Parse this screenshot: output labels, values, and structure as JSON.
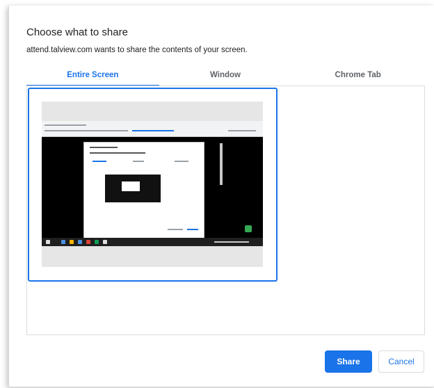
{
  "dialog": {
    "title": "Choose what to share",
    "subtitle": "attend.talview.com wants to share the contents of your screen."
  },
  "tabs": [
    {
      "label": "Entire Screen",
      "active": true
    },
    {
      "label": "Window",
      "active": false
    },
    {
      "label": "Chrome Tab",
      "active": false
    }
  ],
  "buttons": {
    "share_label": "Share",
    "cancel_label": "Cancel"
  },
  "colors": {
    "accent": "#1a73e8",
    "tab_inactive": "#5f6368",
    "border": "#dadce0"
  },
  "icons": {
    "screen_thumbnail": "screen-thumbnail-icon"
  }
}
